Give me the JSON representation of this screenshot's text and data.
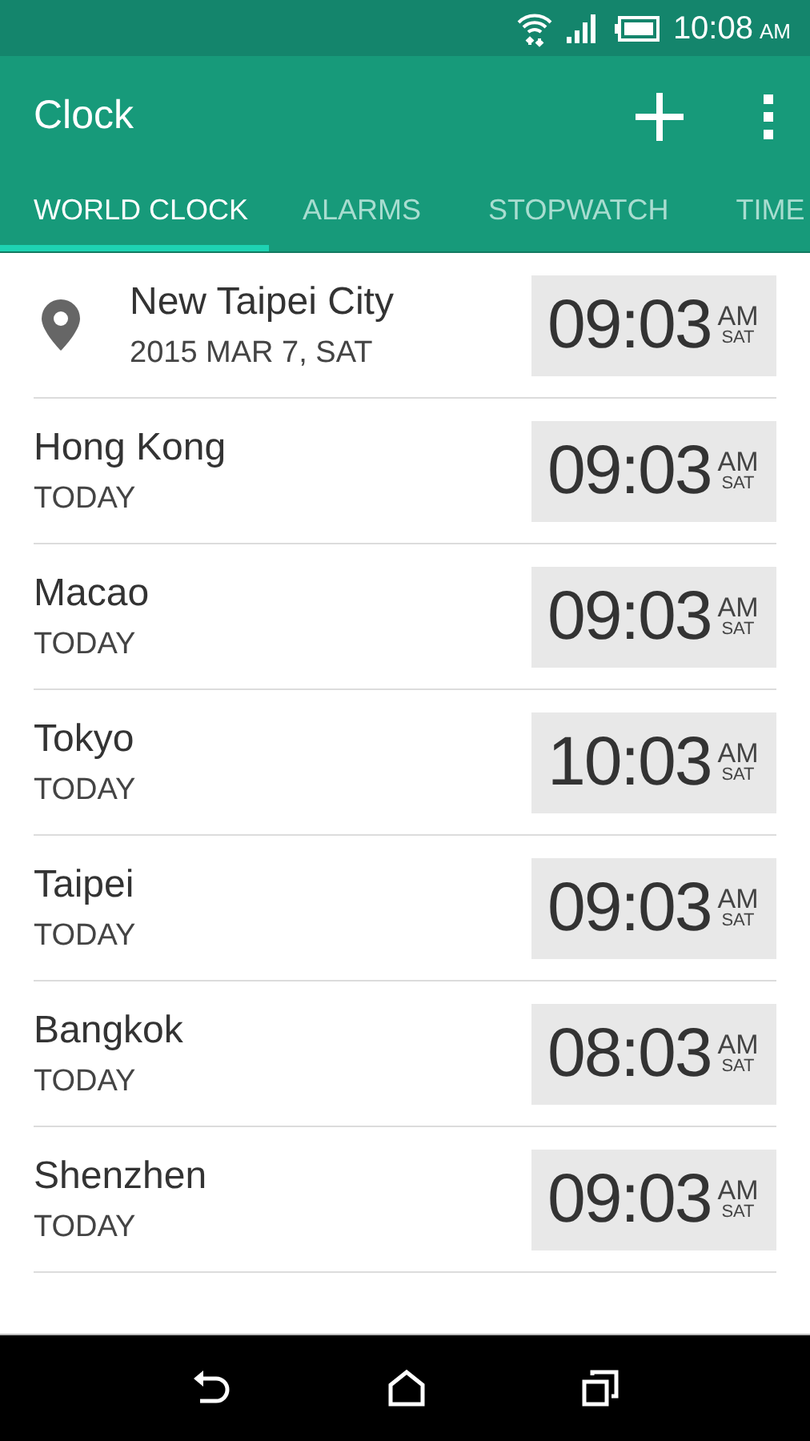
{
  "status_bar": {
    "time": "10:08",
    "meridiem": "AM"
  },
  "app_bar": {
    "title": "Clock"
  },
  "tabs": [
    {
      "label": "WORLD CLOCK",
      "selected": true
    },
    {
      "label": "ALARMS",
      "selected": false
    },
    {
      "label": "STOPWATCH",
      "selected": false
    },
    {
      "label": "TIME",
      "selected": false
    }
  ],
  "cities": [
    {
      "kind": "current",
      "name": "New Taipei City",
      "date": "2015 MAR 7, SAT",
      "time": "09:03",
      "meridiem": "AM",
      "day": "SAT"
    },
    {
      "kind": "city",
      "name": "Hong Kong",
      "date": "TODAY",
      "time": "09:03",
      "meridiem": "AM",
      "day": "SAT"
    },
    {
      "kind": "city",
      "name": "Macao",
      "date": "TODAY",
      "time": "09:03",
      "meridiem": "AM",
      "day": "SAT"
    },
    {
      "kind": "city",
      "name": "Tokyo",
      "date": "TODAY",
      "time": "10:03",
      "meridiem": "AM",
      "day": "SAT"
    },
    {
      "kind": "city",
      "name": "Taipei",
      "date": "TODAY",
      "time": "09:03",
      "meridiem": "AM",
      "day": "SAT"
    },
    {
      "kind": "city",
      "name": "Bangkok",
      "date": "TODAY",
      "time": "08:03",
      "meridiem": "AM",
      "day": "SAT"
    },
    {
      "kind": "city",
      "name": "Shenzhen",
      "date": "TODAY",
      "time": "09:03",
      "meridiem": "AM",
      "day": "SAT"
    }
  ]
}
